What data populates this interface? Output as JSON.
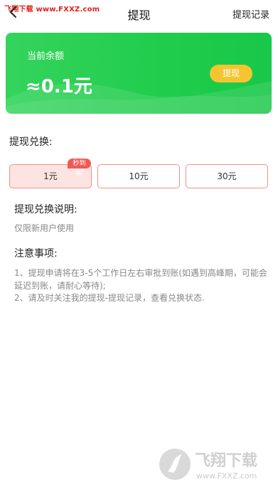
{
  "watermark": {
    "top_text": "飞翔下载 www.FXXZ.com",
    "logo_text": "飞翔下载",
    "logo_url": "www.FXXZ.com"
  },
  "header": {
    "title": "提现",
    "records_link": "提现记录"
  },
  "balance": {
    "label": "当前余额",
    "value": "≈0.1元",
    "button": "提现"
  },
  "exchange": {
    "label": "提现兑换:",
    "options": [
      {
        "label": "1元",
        "badge": "秒到账",
        "selected": true
      },
      {
        "label": "10元",
        "selected": false
      },
      {
        "label": "30元",
        "selected": false
      }
    ]
  },
  "description": {
    "title": "提现兑换说明:",
    "text": "仅限新用户使用"
  },
  "notes": {
    "title": "注意事项:",
    "line1a": "1、提现申请将在3-5个工作日左右审批到账(如遇到高峰期，可能会",
    "line1b": "延迟到账，请耐心等待);",
    "line2": "2、请及时关注我的提现-提现记录，查看兑换状态."
  },
  "colors": {
    "primary_green": "#20cc4c",
    "accent_yellow": "#f7c431",
    "option_border": "#f0908c",
    "badge_red": "#f05a53"
  },
  "icons": {
    "back": "chevron-left-icon"
  }
}
